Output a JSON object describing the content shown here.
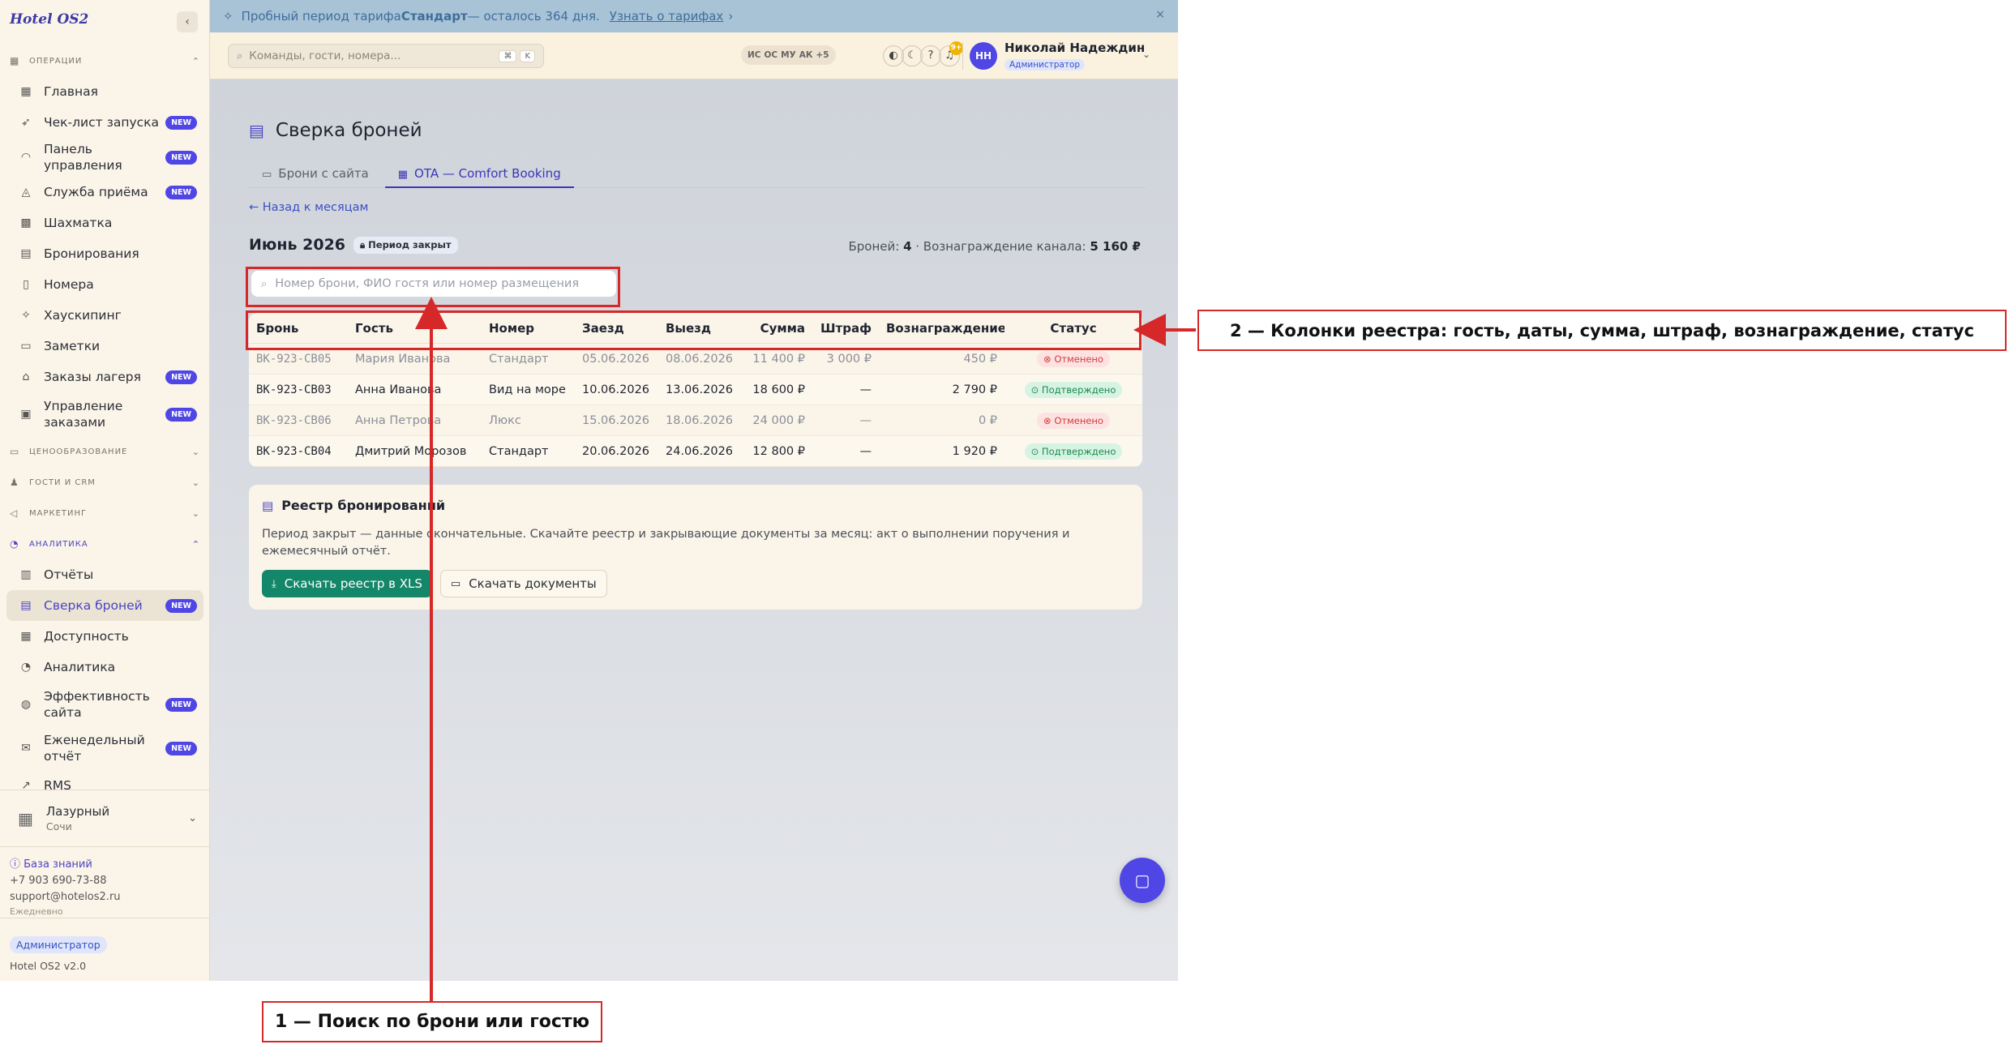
{
  "sidebar": {
    "brand": "Hotel OS2",
    "collapse_icon": "chevron-left-icon",
    "sections": [
      {
        "label": "ОПЕРАЦИИ",
        "icon": "operations-icon",
        "expanded": true,
        "items": [
          {
            "label": "Главная",
            "icon": "grid-icon",
            "new": ""
          },
          {
            "label": "Чек-лист запуска",
            "icon": "rocket-icon",
            "new": "NEW"
          },
          {
            "label": "Панель управления",
            "icon": "gauge-icon",
            "new": "NEW"
          },
          {
            "label": "Служба приёма",
            "icon": "bell-desk-icon",
            "new": "NEW"
          },
          {
            "label": "Шахматка",
            "icon": "chessboard-icon",
            "new": ""
          },
          {
            "label": "Бронирования",
            "icon": "clipboard-icon",
            "new": ""
          },
          {
            "label": "Номера",
            "icon": "door-icon",
            "new": ""
          },
          {
            "label": "Хаускипинг",
            "icon": "sparkle-icon",
            "new": ""
          },
          {
            "label": "Заметки",
            "icon": "note-icon",
            "new": ""
          },
          {
            "label": "Заказы лагеря",
            "icon": "tent-icon",
            "new": "NEW"
          },
          {
            "label": "Управление заказами",
            "icon": "order-icon",
            "new": "NEW"
          }
        ]
      },
      {
        "label": "ЦЕНООБРАЗОВАНИЕ",
        "icon": "pricing-icon",
        "expanded": false,
        "items": []
      },
      {
        "label": "ГОСТИ И CRM",
        "icon": "users-icon",
        "expanded": false,
        "items": []
      },
      {
        "label": "МАРКЕТИНГ",
        "icon": "megaphone-icon",
        "expanded": false,
        "items": []
      },
      {
        "label": "АНАЛИТИКА",
        "icon": "analytics-icon",
        "expanded": true,
        "items": [
          {
            "label": "Отчёты",
            "icon": "bar-chart-icon",
            "new": ""
          },
          {
            "label": "Сверка броней",
            "icon": "reconcile-icon",
            "new": "NEW",
            "selected": true
          },
          {
            "label": "Доступность",
            "icon": "table-icon",
            "new": ""
          },
          {
            "label": "Аналитика",
            "icon": "pie-icon",
            "new": ""
          },
          {
            "label": "Эффективность сайта",
            "icon": "globe-icon",
            "new": "NEW"
          },
          {
            "label": "Еженедельный отчёт",
            "icon": "mail-icon",
            "new": "NEW"
          },
          {
            "label": "RMS",
            "icon": "trend-icon",
            "new": ""
          }
        ]
      }
    ],
    "hotel": {
      "name": "Лазурный",
      "city": "Сочи",
      "icon": "building-icon"
    },
    "support": {
      "kb_label": "База знаний",
      "phone": "+7 903 690-73-88",
      "email": "support@hotelos2.ru",
      "schedule": "Ежедневно"
    },
    "role": "Администратор",
    "version": "Hotel OS2 v2.0"
  },
  "trial_banner": {
    "prefix": "Пробный период тарифа ",
    "plan": "Стандарт",
    "suffix": " — осталось 364 дня.",
    "link": "Узнать о тарифах",
    "link_arrow": "›",
    "close": "×"
  },
  "topbar": {
    "search_placeholder": "Команды, гости, номера...",
    "kbd1": "⌘",
    "kbd2": "K",
    "presence": [
      "ИС",
      "ОС",
      "МУ",
      "АК",
      "+5"
    ],
    "notifications": "9+",
    "user_initials": "НН",
    "user_name": "Николай Надеждин",
    "user_role": "Администратор"
  },
  "page": {
    "title": "Сверка броней",
    "tabs": [
      {
        "label": "Брони с сайта",
        "icon": "doc-icon",
        "active": false
      },
      {
        "label": "OTA — Comfort Booking",
        "icon": "hotel-icon",
        "active": true
      }
    ],
    "back_label": "← Назад к месяцам",
    "month": "Июнь 2026",
    "period_badge": "Период закрыт",
    "summary_prefix": "Броней: ",
    "summary_count": "4",
    "summary_mid": " · Вознаграждение канала: ",
    "summary_amount": "5 160 ₽",
    "search_placeholder": "Номер брони, ФИО гостя или номер размещения"
  },
  "table": {
    "headers": [
      "Бронь",
      "Гость",
      "Номер",
      "Заезд",
      "Выезд",
      "Сумма",
      "Штраф",
      "Вознаграждение",
      "Статус"
    ],
    "rows": [
      {
        "id": "BK-923-CB05",
        "guest": "Мария Иванова",
        "room": "Стандарт",
        "checkin": "05.06.2026",
        "checkout": "08.06.2026",
        "sum": "11 400 ₽",
        "fine": "3 000 ₽",
        "reward": "450 ₽",
        "status": "Отменено",
        "kind": "cancelled"
      },
      {
        "id": "BK-923-CB03",
        "guest": "Анна Иванова",
        "room": "Вид на море",
        "checkin": "10.06.2026",
        "checkout": "13.06.2026",
        "sum": "18 600 ₽",
        "fine": "—",
        "reward": "2 790 ₽",
        "status": "Подтверждено",
        "kind": "confirmed"
      },
      {
        "id": "BK-923-CB06",
        "guest": "Анна Петрова",
        "room": "Люкс",
        "checkin": "15.06.2026",
        "checkout": "18.06.2026",
        "sum": "24 000 ₽",
        "fine": "—",
        "reward": "0 ₽",
        "status": "Отменено",
        "kind": "cancelled"
      },
      {
        "id": "BK-923-CB04",
        "guest": "Дмитрий Морозов",
        "room": "Стандарт",
        "checkin": "20.06.2026",
        "checkout": "24.06.2026",
        "sum": "12 800 ₽",
        "fine": "—",
        "reward": "1 920 ₽",
        "status": "Подтверждено",
        "kind": "confirmed"
      }
    ]
  },
  "registry": {
    "title": "Реестр бронирований",
    "description": "Период закрыт — данные окончательные. Скачайте реестр и закрывающие документы за месяц: акт о выполнении поручения и ежемесячный отчёт.",
    "btn_xls": "Скачать реестр в XLS",
    "btn_docs": "Скачать документы"
  },
  "annotations": {
    "callout_1": "1 — Поиск по брони или гостю",
    "callout_2": "2 — Колонки реестра: гость, даты, сумма, штраф, вознаграждение, статус",
    "color": "#d62828"
  },
  "colors": {
    "accent": "#4f46e5",
    "sidebar_bg": "#fbf4e8",
    "success": "#14866a",
    "danger": "#d23c3c"
  }
}
